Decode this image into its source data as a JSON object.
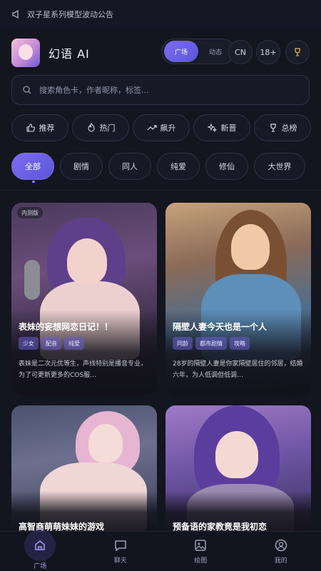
{
  "notice": {
    "text": "双子星系列模型波动公告",
    "icon": "megaphone-icon"
  },
  "header": {
    "brand": "幻语 AI",
    "seg": {
      "square": "广场",
      "dynamic": "动态"
    },
    "lang": "CN",
    "age": "18+",
    "trophy_icon": "trophy-icon"
  },
  "search": {
    "placeholder": "搜索角色卡，作者昵称，标签...",
    "icon": "search-icon"
  },
  "quick": [
    {
      "label": "推荐",
      "icon": "thumbs-up-icon"
    },
    {
      "label": "热门",
      "icon": "flame-icon"
    },
    {
      "label": "飙升",
      "icon": "trend-up-icon"
    },
    {
      "label": "新晋",
      "icon": "sparkle-icon"
    },
    {
      "label": "总榜",
      "icon": "trophy-icon"
    }
  ],
  "categories": [
    "全部",
    "剧情",
    "同人",
    "纯爱",
    "修仙",
    "大世界"
  ],
  "cards": [
    {
      "corner": "内测版",
      "title": "表妹的妄想网恋日记！！",
      "tags": [
        "少女",
        "配音",
        "纯爱"
      ],
      "desc": "表妹是二次元优等生，声线特别是播音专业，为了可更新更多的COS服…"
    },
    {
      "title": "隔壁人妻今天也是一个人",
      "tags": [
        "同龄",
        "都市剧情",
        "攻略"
      ],
      "desc": "28岁的隔壁人妻是你家隔壁居住的邻居，结婚六年，为人低调但低调…"
    },
    {
      "title": "高智商萌萌妹妹的游戏",
      "tags": [],
      "desc": ""
    },
    {
      "title": "预备语的家教竟是我初恋",
      "tags": [],
      "desc": ""
    }
  ],
  "tabbar": [
    {
      "label": "广场",
      "icon": "home-icon"
    },
    {
      "label": "聊天",
      "icon": "chat-icon"
    },
    {
      "label": "绘图",
      "icon": "image-icon"
    },
    {
      "label": "我的",
      "icon": "profile-icon"
    }
  ]
}
